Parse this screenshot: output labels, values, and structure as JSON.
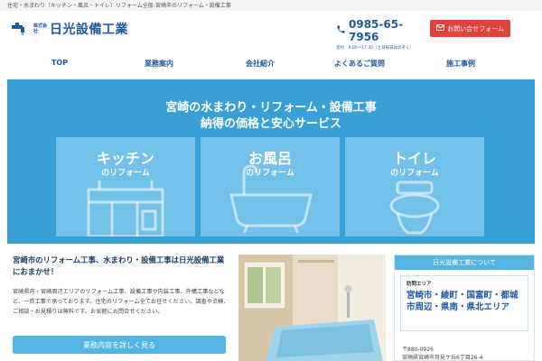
{
  "topbar": {
    "text": "住宅・水まわり（キッチン・風呂・トイレ）リフォーム全般-宮崎市のリフォーム・設備工事"
  },
  "header": {
    "logo_small": "株式会社",
    "logo_name": "日光設備工業",
    "phone": "0985-65-7956",
    "hours": "受付：9:00〜17:30（土日祝日はのぞく）",
    "contact_label": "お問い合せフォーム"
  },
  "nav": {
    "items": [
      "TOP",
      "業務案内",
      "会社紹介",
      "よくあるご質問",
      "施工事例"
    ]
  },
  "hero": {
    "line1": "宮崎の水まわり・リフォーム・設備工事",
    "line2": "納得の価格と安心サービス",
    "cards": [
      {
        "title": "キッチン",
        "sub": "のリフォーム"
      },
      {
        "title": "お風呂",
        "sub": "のリフォーム"
      },
      {
        "title": "トイレ",
        "sub": "のリフォーム"
      }
    ]
  },
  "intro": {
    "headline": "宮崎市のリフォーム工事、水まわり・設備工事は日光設備工業におまかせ！",
    "body": "宮崎県内・宮崎周辺エリアのリフォーム工事、設備工事や内装工事、外構工事などなど、一貫工事で承っております。住宅のリフォーム全てお任せください。調査や点検、ご相談・お見積りは無料です。お気軽にお問合せください。",
    "button_label": "業務内容を詳しく見る"
  },
  "aside": {
    "title": "日光設備工業について",
    "area_label": "訪問エリア",
    "area_text": "宮崎市・綾町・国富町・都城市周辺・県南・県北エリア",
    "zip": "〒880-0926",
    "address": "宮崎県宮崎市月見ケ丘6丁目26-4"
  },
  "colors": {
    "brand": "#1e5a9e",
    "hero": "#39a0d6",
    "card": "#73c0e8",
    "accent": "#e0433a",
    "button": "#54b4e2"
  }
}
